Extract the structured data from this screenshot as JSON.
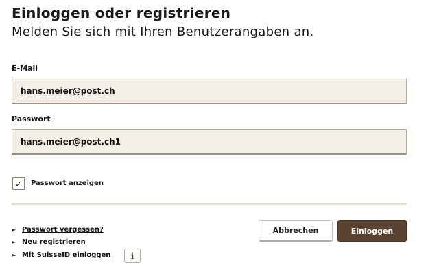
{
  "header": {
    "title": "Einloggen oder registrieren",
    "subtitle": "Melden Sie sich mit Ihren Benutzerangaben an."
  },
  "form": {
    "email": {
      "label": "E-Mail",
      "value": "hans.meier@post.ch"
    },
    "password": {
      "label": "Passwort",
      "value": "hans.meier@post.ch1"
    },
    "show_password": {
      "label": "Passwort anzeigen",
      "checked": true,
      "check_glyph": "✓"
    }
  },
  "links": [
    {
      "arrow": "►",
      "label": "Passwort vergessen?"
    },
    {
      "arrow": "►",
      "label": "Neu registrieren"
    },
    {
      "arrow": "►",
      "label": "Mit SuisseID einloggen"
    }
  ],
  "info_icon": {
    "glyph": "i",
    "icon": "info-icon"
  },
  "buttons": {
    "cancel": "Abbrechen",
    "login": "Einloggen"
  },
  "colors": {
    "input_bg": "#f3efe6",
    "primary_button": "#5a4330",
    "divider": "#e3ddd0"
  }
}
